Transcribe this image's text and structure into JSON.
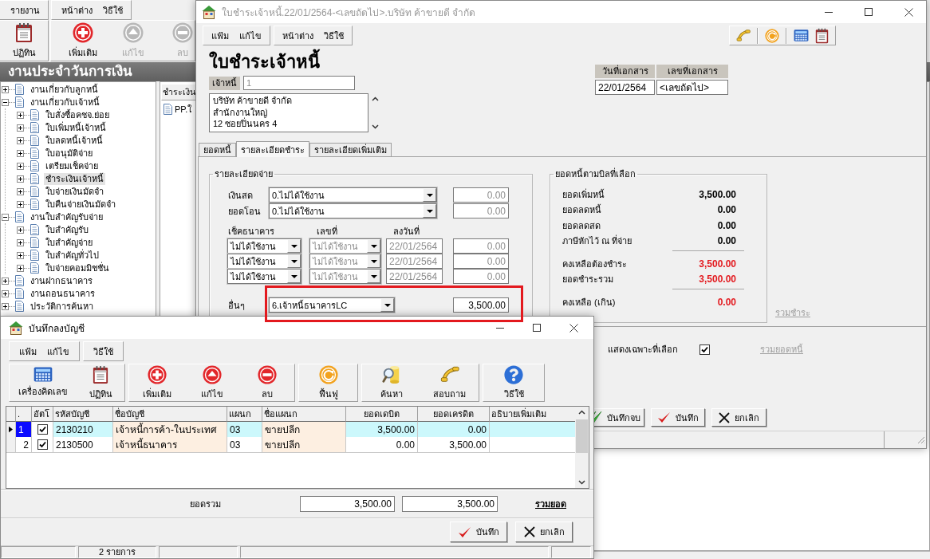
{
  "background_app": {
    "menu_groups": [
      {
        "items": [
          "รายงาน"
        ]
      },
      {
        "items": [
          "หน้าต่าง",
          "วิธีใช้"
        ]
      }
    ],
    "toolbar_groups": [
      {
        "items": [
          {
            "label": "ปฏิทิน",
            "kind": "calendar",
            "disabled": false
          }
        ]
      },
      {
        "items": [
          {
            "label": "เพิ่มเติม",
            "kind": "add",
            "disabled": false
          },
          {
            "label": "แก้ไข",
            "kind": "edit",
            "disabled": true
          },
          {
            "label": "ลบ",
            "kind": "delete",
            "disabled": true
          }
        ]
      }
    ],
    "panel_title": "งานประจำวันการเงิน",
    "tree": [
      {
        "label": "งานเกี่ยวกับลูกหนี้",
        "expanded": false,
        "selected": false
      },
      {
        "label": "งานเกี่ยวกับเจ้าหนี้",
        "expanded": true,
        "selected": false,
        "children": [
          {
            "label": "ใบสั่งซื้อคชจ.ย่อย",
            "expanded": false,
            "selected": false
          },
          {
            "label": "ใบเพิ่มหนี้เจ้าหนี้",
            "expanded": false,
            "selected": false
          },
          {
            "label": "ใบลดหนี้เจ้าหนี้",
            "expanded": false,
            "selected": false
          },
          {
            "label": "ใบอนุมัติจ่าย",
            "expanded": false,
            "selected": false
          },
          {
            "label": "เตรียมเช็คจ่าย",
            "expanded": false,
            "selected": false
          },
          {
            "label": "ชำระเงินเจ้าหนี้",
            "expanded": false,
            "selected": true
          },
          {
            "label": "ใบจ่ายเงินมัดจำ",
            "expanded": false,
            "selected": false
          },
          {
            "label": "ใบคืนจ่ายเงินมัดจำ",
            "expanded": false,
            "selected": false
          }
        ]
      },
      {
        "label": "งานใบสำคัญรับจ่าย",
        "expanded": true,
        "selected": false,
        "children": [
          {
            "label": "ใบสำคัญรับ",
            "expanded": false,
            "selected": false
          },
          {
            "label": "ใบสำคัญจ่าย",
            "expanded": false,
            "selected": false
          },
          {
            "label": "ใบสำคัญทั่วไป",
            "expanded": false,
            "selected": false
          },
          {
            "label": "ใบจ่ายคอมมิชชั่น",
            "expanded": false,
            "selected": false
          }
        ]
      },
      {
        "label": "งานฝากธนาคาร",
        "expanded": false,
        "selected": false
      },
      {
        "label": "งานถอนธนาคาร",
        "expanded": false,
        "selected": false
      },
      {
        "label": "ประวัติการค้นหา",
        "expanded": false,
        "selected": false
      }
    ],
    "list": {
      "header": "ชำระเงิน",
      "items": [
        {
          "label": "PP.ใ"
        }
      ]
    }
  },
  "main_window": {
    "title": "ใบชำระเจ้าหนี้.22/01/2564-<เลขถัดไป>.บริษัท ค้าขายดี จำกัด",
    "active": false,
    "menu_groups": [
      {
        "items": [
          "แฟ้ม",
          "แก้ไข"
        ]
      },
      {
        "items": [
          "หน้าต่าง",
          "วิธีใช้"
        ]
      }
    ],
    "heading": "ใบชำระเจ้าหนี้",
    "creditor": {
      "label": "เจ้าหนี้",
      "value": "1",
      "disabled": true
    },
    "address_lines": [
      "บริษัท ค้าขายดี จำกัด",
      "สำนักงานใหญ่",
      "12 ซอยปิ่นนคร 4"
    ],
    "document_fields": [
      {
        "label": "วันที่เอกสาร",
        "value": "22/01/2564"
      },
      {
        "label": "เลขที่เอกสาร",
        "value": "<เลขถัดไป>"
      }
    ],
    "tabs": [
      {
        "label": "ยอดหนี้",
        "selected": false
      },
      {
        "label": "รายละเอียดชำระ",
        "selected": true
      },
      {
        "label": "รายละเอียดเพิ่มเติม",
        "selected": false
      }
    ],
    "payment": {
      "title": "รายละเอียดจ่าย",
      "methods": [
        {
          "label": "เงินสด",
          "option": "0.ไม่ได้ใช้งาน",
          "amount": "0.00",
          "amount_disabled": true
        },
        {
          "label": "ยอดโอน",
          "option": "0.ไม่ได้ใช้งาน",
          "amount": "0.00",
          "amount_disabled": true
        }
      ],
      "cheque_columns": [
        "เช็คธนาคาร",
        "เลขที่",
        "ลงวันที่"
      ],
      "cheques": [
        {
          "bank": "ไม่ได้ใช้งาน",
          "number": "ไม่ได้ใช้งาน",
          "date": "22/01/2564",
          "amount": "0.00",
          "disabled": true
        },
        {
          "bank": "ไม่ได้ใช้งาน",
          "number": "ไม่ได้ใช้งาน",
          "date": "22/01/2564",
          "amount": "0.00",
          "disabled": true
        },
        {
          "bank": "ไม่ได้ใช้งาน",
          "number": "ไม่ได้ใช้งาน",
          "date": "22/01/2564",
          "amount": "0.00",
          "disabled": true
        }
      ],
      "other": {
        "label": "อื่นๆ",
        "option": "6.เจ้าหนี้ธนาคารLC",
        "amount": "3,500.00",
        "amount_disabled": false
      }
    },
    "summary": {
      "title": "ยอดหนี้ตามบิลที่เลือก",
      "sections": [
        {
          "rows": [
            {
              "label": "ยอดเพิ่มหนี้",
              "value": "3,500.00",
              "color": "#000000"
            },
            {
              "label": "ยอดลดหนี้",
              "value": "0.00",
              "color": "#000000"
            },
            {
              "label": "ยอดลดสด",
              "value": "0.00",
              "color": "#000000"
            },
            {
              "label": "ภาษีหักไว้ ณ ที่จ่าย",
              "value": "0.00",
              "color": "#000000"
            }
          ]
        },
        {
          "rows": [
            {
              "label": "คงเหลือต้องชำระ",
              "value": "3,500.00",
              "color": "#e3191e"
            },
            {
              "label": "ยอดชำระรวม",
              "value": "3,500.00",
              "color": "#e3191e"
            }
          ]
        },
        {
          "rows": [
            {
              "label": "คงเหลือ (เกิน)",
              "value": "0.00",
              "color": "#e3191e"
            }
          ]
        }
      ]
    },
    "summary_link": {
      "label": "รวมชำระ",
      "disabled": true
    },
    "show_selected": {
      "label": "แสดงเฉพาะที่เลือก",
      "checked": true
    },
    "debt_total_link": {
      "label": "รวมยอดหนี้",
      "disabled": true
    },
    "buttons": [
      {
        "label": "บันทึกจบ",
        "kind": "save_close"
      },
      {
        "label": "บันทึก",
        "kind": "save"
      },
      {
        "label": "ยกเลิก",
        "kind": "cancel"
      }
    ]
  },
  "dialog": {
    "title": "บันทึกลงบัญชี",
    "active": true,
    "menu_groups": [
      {
        "items": [
          "แฟ้ม",
          "แก้ไข"
        ]
      },
      {
        "items": [
          "วิธีใช้"
        ]
      }
    ],
    "toolbar_groups": [
      {
        "items": [
          {
            "label": "เครื่องคิดเลข",
            "kind": "calculator"
          },
          {
            "label": "ปฏิทิน",
            "kind": "calendar"
          }
        ]
      },
      {
        "items": [
          {
            "label": "เพิ่มเติม",
            "kind": "add"
          },
          {
            "label": "แก้ไข",
            "kind": "edit"
          },
          {
            "label": "ลบ",
            "kind": "delete"
          }
        ]
      },
      {
        "items": [
          {
            "label": "ฟื้นฟู",
            "kind": "refresh"
          }
        ]
      },
      {
        "items": [
          {
            "label": "ค้นหา",
            "kind": "search"
          },
          {
            "label": "สอบถาม",
            "kind": "phone"
          }
        ]
      },
      {
        "items": [
          {
            "label": "วิธีใช้",
            "kind": "help"
          }
        ]
      }
    ],
    "table": {
      "columns": [
        ".",
        "อัตโ",
        "รหัสบัญชี",
        "ชื่อบัญชี",
        "แผนก",
        "ชื่อแผนก",
        "ยอดเดบิต",
        "ยอดเครดิต",
        "อธิบายเพิ่มเติม"
      ],
      "rows": [
        {
          "selected": true,
          "no": "1",
          "auto": true,
          "code": "2130210",
          "name": "เจ้าหนี้การค้า-ในประเทศ",
          "dept": "03",
          "dept_name": "ขายปลีก",
          "debit": "3,500.00",
          "credit": "0.00"
        },
        {
          "selected": false,
          "no": "2",
          "auto": true,
          "code": "2130500",
          "name": "เจ้าหนี้ธนาคาร",
          "dept": "03",
          "dept_name": "ขายปลีก",
          "debit": "0.00",
          "credit": "3,500.00"
        }
      ]
    },
    "totals": {
      "label": "ยอดรวม",
      "debit": "3,500.00",
      "credit": "3,500.00",
      "link": {
        "label": "รวมยอด",
        "disabled": false
      }
    },
    "buttons": [
      {
        "label": "บันทึก",
        "kind": "save"
      },
      {
        "label": "ยกเลิก",
        "kind": "cancel"
      }
    ],
    "status_bar": {
      "record_count": "2 รายการ"
    }
  }
}
